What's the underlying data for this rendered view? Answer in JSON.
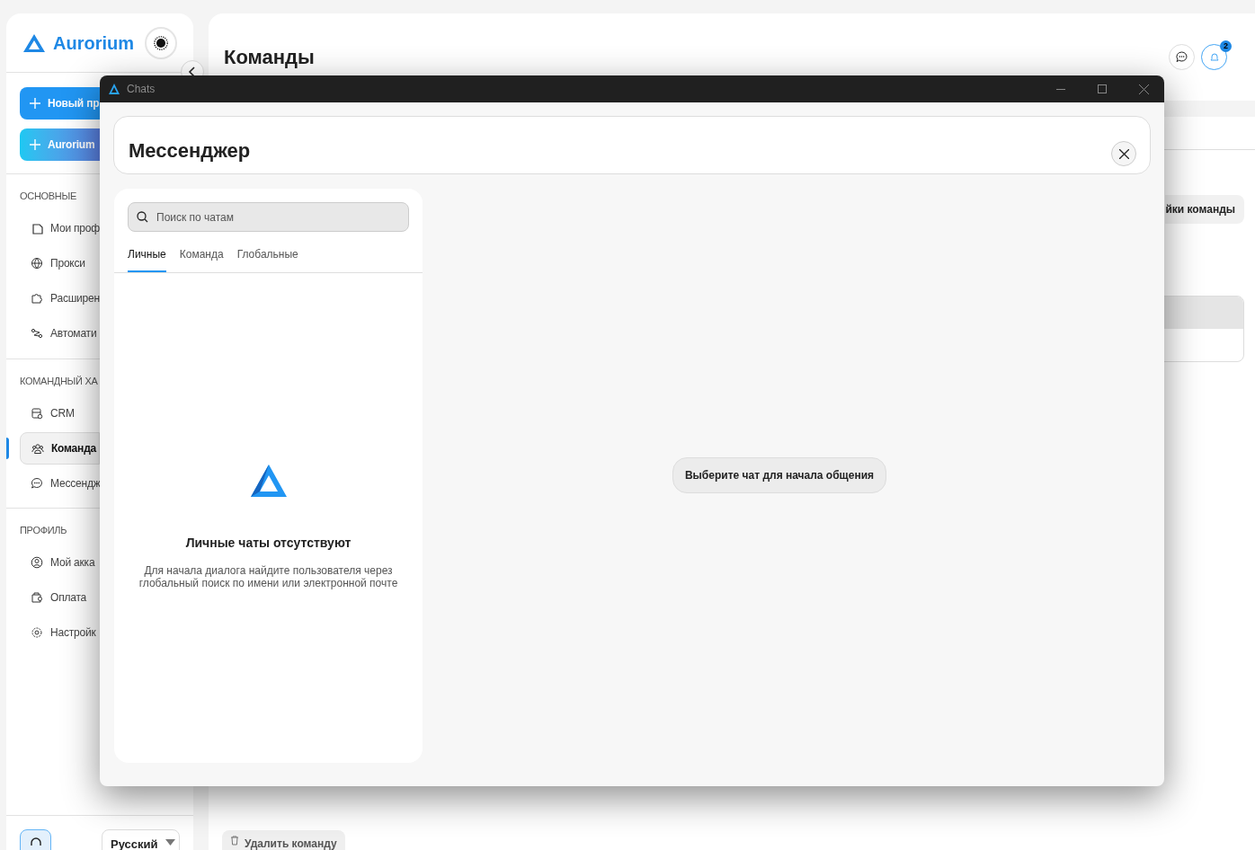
{
  "sidebar": {
    "brand": "Aurorium",
    "buttons": [
      {
        "label": "Новый пр",
        "kind": "primary"
      },
      {
        "label": "Aurorium",
        "kind": "gradient"
      }
    ],
    "sections": [
      {
        "title": "ОСНОВНЫЕ",
        "items": [
          {
            "label": "Мои проф",
            "selected": false
          },
          {
            "label": "Прокси",
            "selected": false
          },
          {
            "label": "Расширен",
            "selected": false
          },
          {
            "label": "Автомати",
            "selected": false
          }
        ]
      },
      {
        "title": "КОМАНДНЫЙ ХА",
        "items": [
          {
            "label": "CRM",
            "selected": false
          },
          {
            "label": "Команда",
            "selected": true
          },
          {
            "label": "Мессендж",
            "selected": false
          }
        ]
      },
      {
        "title": "ПРОФИЛЬ",
        "items": [
          {
            "label": "Мой акка",
            "selected": false
          },
          {
            "label": "Оплата",
            "selected": false
          },
          {
            "label": "Настройк",
            "selected": false
          }
        ]
      }
    ],
    "language": "Русский"
  },
  "page": {
    "title": "Команды",
    "notification_count": "2",
    "settings_button": "йки команды",
    "delete_button": "Удалить команду"
  },
  "chat_window": {
    "title": "Chats",
    "heading": "Мессенджер",
    "search": {
      "placeholder": "Поиск по чатам"
    },
    "tabs": [
      {
        "label": "Личные",
        "selected": true
      },
      {
        "label": "Команда",
        "selected": false
      },
      {
        "label": "Глобальные",
        "selected": false
      }
    ],
    "empty_title": "Личные чаты отсутствуют",
    "empty_text": "Для начала диалога найдите пользователя через глобальный поиск по имени или электронной почте",
    "placeholder_message": "Выберите чат для начала общения"
  }
}
